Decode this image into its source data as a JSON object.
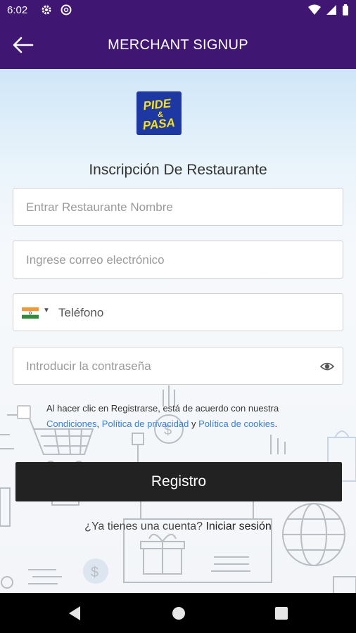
{
  "status_bar": {
    "time": "6:02"
  },
  "app_bar": {
    "title": "MERCHANT SIGNUP"
  },
  "logo": {
    "line1": "PIDE",
    "line2": "&",
    "line3": "PASA"
  },
  "form": {
    "heading": "Inscripción De Restaurante",
    "restaurant_name": {
      "placeholder": "Entrar Restaurante Nombre",
      "value": ""
    },
    "email": {
      "placeholder": "Ingrese correo electrónico",
      "value": ""
    },
    "phone": {
      "placeholder": "Teléfono",
      "value": "",
      "country_flag": "india-flag"
    },
    "password": {
      "placeholder": "Introducir la contraseña",
      "value": ""
    }
  },
  "terms": {
    "prefix": "Al hacer clic en Registrarse, está de acuerdo con nuestra",
    "conditions": "Condiciones",
    "comma": ",",
    "privacy": "Política de privacidad",
    "and": "y",
    "cookies": "Política de cookies",
    "period": "."
  },
  "register_button": "Registro",
  "login": {
    "question": "¿Ya tienes una cuenta?",
    "link": "Iniciar sesión"
  },
  "colors": {
    "header": "#3f1772",
    "button": "#222222",
    "link": "#3a7fd6",
    "logo_bg": "#1d37a3",
    "logo_text": "#f7e11a"
  }
}
